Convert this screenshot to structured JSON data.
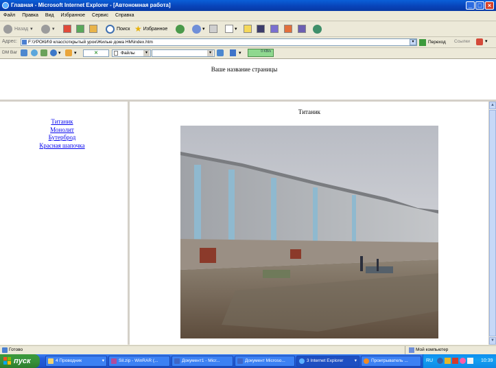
{
  "window": {
    "title": "Главная - Microsoft Internet Explorer - [Автономная работа]"
  },
  "menu": {
    "items": [
      "Файл",
      "Правка",
      "Вид",
      "Избранное",
      "Сервис",
      "Справка"
    ]
  },
  "toolbar": {
    "back_label": "Назад",
    "search_label": "Поиск",
    "favorites_label": "Избранное"
  },
  "address": {
    "label": "Адрес:",
    "value": "F:\\УРОКИ\\9 класс\\открытый урок\\Жилые дома НМ\\index.htm",
    "go_label": "Переход",
    "links_label": "Ссылки"
  },
  "dmbar": {
    "label": "DM Bar",
    "files_label": "Файлы",
    "progress_text": "0 KB/s"
  },
  "page": {
    "heading": "Ваше название страницы",
    "nav_links": [
      "Титаник",
      "Монолит",
      "Бутерброд",
      "Красная шапочка"
    ],
    "main_title": "Титаник"
  },
  "status": {
    "left": "Готово",
    "zone": "Мой компьютер"
  },
  "taskbar": {
    "start_label": "пуск",
    "tasks": [
      "4 Проводник",
      "Sil.zip - WinRAR (...",
      "Документ1 - Micr...",
      "Документ Microso...",
      "3 Internet Explorer",
      "Проигрыватель ..."
    ],
    "language": "RU",
    "clock": "10:39"
  },
  "colors": {
    "titlebar": "#0842b7",
    "link": "#0000ee",
    "taskbar": "#245edb",
    "start": "#37923b"
  }
}
